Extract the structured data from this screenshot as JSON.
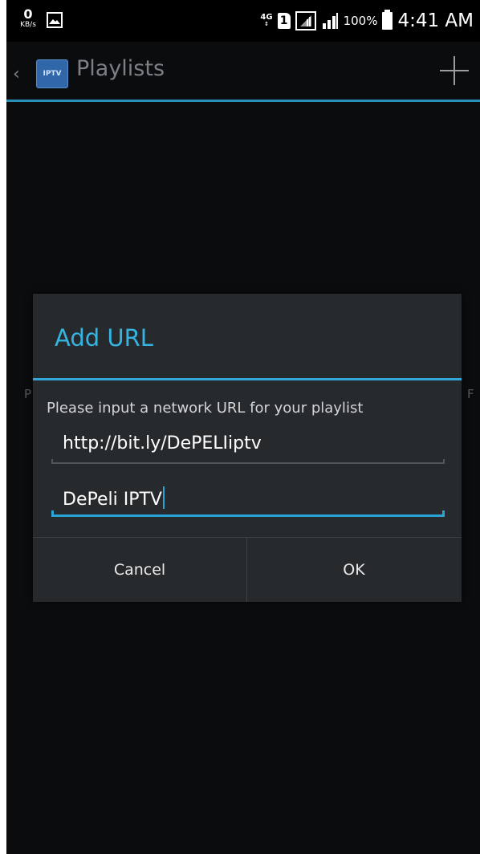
{
  "status_bar": {
    "speed_value": "0",
    "speed_unit": "KB/s",
    "network_type": "4G",
    "sim_slot": "1",
    "battery_percent": "100%",
    "time": "4:41 AM"
  },
  "action_bar": {
    "app_icon_text": "IPTV",
    "title": "Playlists"
  },
  "background": {
    "peek_left": "P",
    "peek_right": "F"
  },
  "dialog": {
    "title": "Add URL",
    "message": "Please input a network URL for your playlist",
    "url_value": "http://bit.ly/DePELIiptv",
    "name_value": "DePeli IPTV",
    "cancel_label": "Cancel",
    "ok_label": "OK"
  },
  "colors": {
    "accent": "#33a7d6",
    "dialog_background": "#272a2d",
    "screen_background": "#0b0c0e"
  }
}
